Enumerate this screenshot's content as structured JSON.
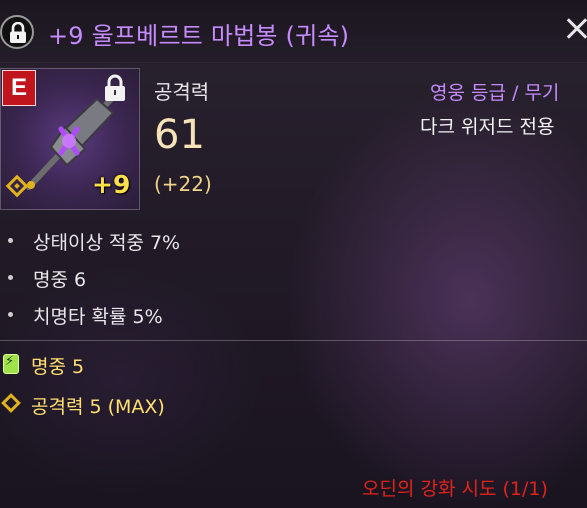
{
  "header": {
    "title": "+9 울프베르트 마법봉 (귀속)",
    "lock_icon": "lock-icon",
    "close_icon": "close-icon"
  },
  "item": {
    "grade_letter": "E",
    "enhance_level": "+9",
    "icon_name": "magic-staff-icon",
    "stat_label": "공격력",
    "stat_value": "61",
    "stat_bonus": "(+22)",
    "grade_class": "영웅 등급 / 무기",
    "class_restrict": "다크 위저드 전용"
  },
  "options": [
    "상태이상 적중 7%",
    "명중 6",
    "치명타 확률 5%"
  ],
  "bonus_options": [
    {
      "icon": "rune-icon",
      "text": "명중 5"
    },
    {
      "icon": "gold-diamond-icon",
      "text": "공격력 5 (MAX)"
    }
  ],
  "footer": {
    "enhance_attempt": "오딘의 강화 시도 (1/1)"
  },
  "colors": {
    "title_purple": "#c58bff",
    "grade_red": "#c0151d",
    "enhance_yellow": "#ffe04a",
    "stat_gold": "#f0d48a",
    "bonus_yellow": "#ffe070",
    "attempt_red": "#e2231a"
  }
}
